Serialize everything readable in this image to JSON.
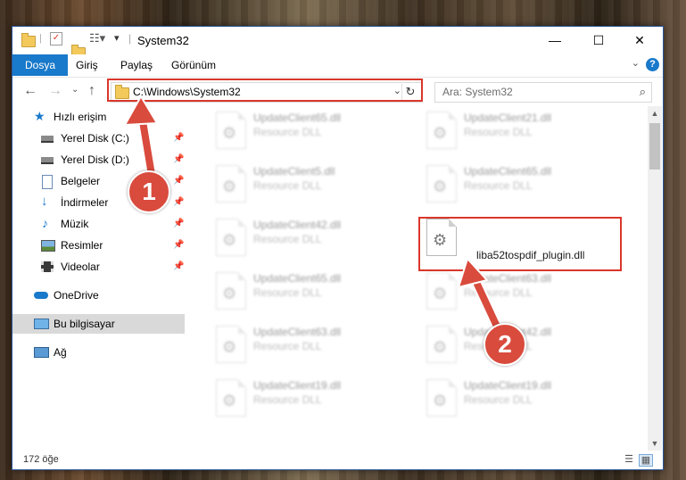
{
  "window": {
    "title": "System32",
    "controls": {
      "minimize": "—",
      "maximize": "☐",
      "close": "✕"
    }
  },
  "ribbon": {
    "tabs": [
      {
        "label": "Dosya",
        "active": true
      },
      {
        "label": "Giriş"
      },
      {
        "label": "Paylaş"
      },
      {
        "label": "Görünüm"
      }
    ],
    "help": "?"
  },
  "navbar": {
    "address": "C:\\Windows\\System32",
    "search_placeholder": "Ara: System32"
  },
  "sidebar": {
    "items": [
      {
        "label": "Hızlı erişim",
        "icon": "star-icon",
        "pinned": false
      },
      {
        "label": "Yerel Disk (C:)",
        "icon": "drive-icon",
        "pinned": true
      },
      {
        "label": "Yerel Disk (D:)",
        "icon": "drive-icon",
        "pinned": true
      },
      {
        "label": "Belgeler",
        "icon": "documents-icon",
        "pinned": true
      },
      {
        "label": "İndirmeler",
        "icon": "download-icon",
        "pinned": true
      },
      {
        "label": "Müzik",
        "icon": "music-icon",
        "pinned": true
      },
      {
        "label": "Resimler",
        "icon": "pictures-icon",
        "pinned": true
      },
      {
        "label": "Videolar",
        "icon": "videos-icon",
        "pinned": true
      },
      {
        "label": "OneDrive",
        "icon": "cloud-icon",
        "pinned": false
      },
      {
        "label": "Bu bilgisayar",
        "icon": "computer-icon",
        "pinned": false,
        "selected": true
      },
      {
        "label": "Ağ",
        "icon": "network-icon",
        "pinned": false
      }
    ]
  },
  "files": [
    {
      "name": "UpdateClient65.dll",
      "type": "Resource DLL"
    },
    {
      "name": "UpdateClient21.dll",
      "type": "Resource DLL"
    },
    {
      "name": "UpdateClient5.dll",
      "type": "Resource DLL"
    },
    {
      "name": "UpdateClient65.dll",
      "type": "Resource DLL"
    },
    {
      "name": "UpdateClient42.dll",
      "type": "Resource DLL"
    },
    {
      "name": "liba52tospdif_plugin.dll",
      "type": ""
    },
    {
      "name": "UpdateClient65.dll",
      "type": "Resource DLL"
    },
    {
      "name": "UpdateClient63.dll",
      "type": "Resource DLL"
    },
    {
      "name": "UpdateClient63.dll",
      "type": "Resource DLL"
    },
    {
      "name": "UpdateClient42.dll",
      "type": "Resource DLL"
    },
    {
      "name": "UpdateClient19.dll",
      "type": "Resource DLL"
    },
    {
      "name": "UpdateClient19.dll",
      "type": "Resource DLL"
    }
  ],
  "status": {
    "item_count": "172 öğe"
  },
  "callouts": {
    "one": "1",
    "two": "2"
  },
  "colors": {
    "accent": "#1979ca",
    "highlight": "#d9372b",
    "callout": "#d94b3d"
  }
}
